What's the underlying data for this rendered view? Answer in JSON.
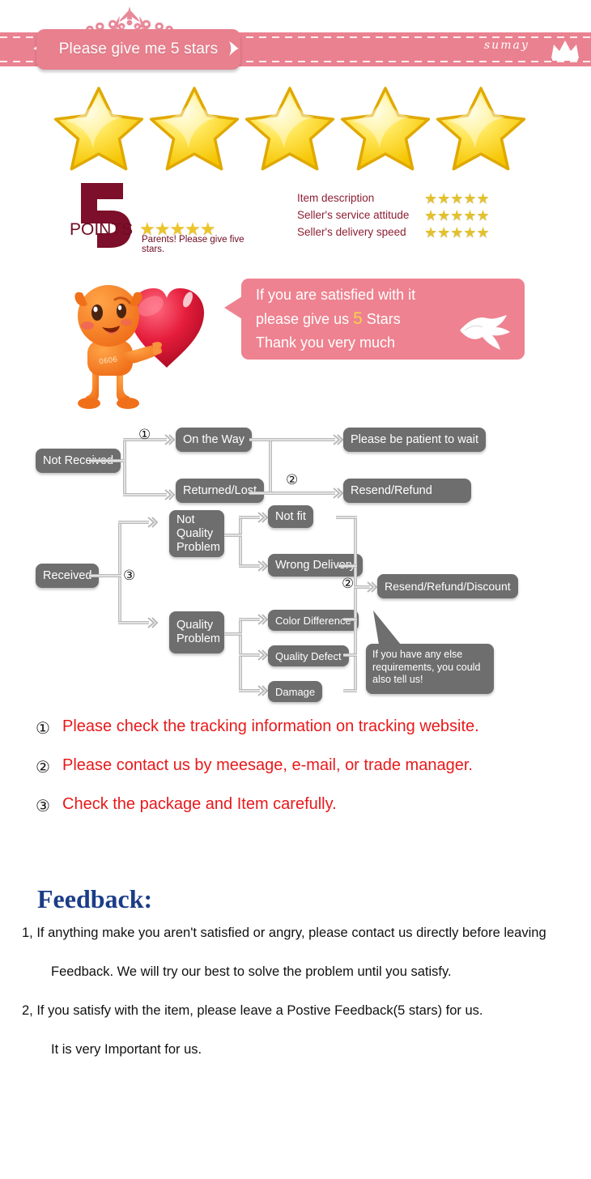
{
  "header": {
    "plate_label": "Please give me 5 stars",
    "brand": "sumay",
    "tiara_icon": "tiara-icon",
    "crown_icon": "crown-icon",
    "band_color": "#ea8190",
    "plate_color": "#e8808e"
  },
  "big_stars": {
    "count": 5,
    "color": "#ffd400"
  },
  "points": {
    "number": "5",
    "label": "POINTS",
    "mini_stars": "★★★★★",
    "caption": "Parents! Please give five stars.",
    "color": "#6e0c22"
  },
  "ratings": {
    "stars": "★★★★★",
    "star_color": "#e3c12b",
    "rows": [
      {
        "label": "Item description"
      },
      {
        "label": "Seller's service attitude"
      },
      {
        "label": "Seller's delivery speed"
      }
    ]
  },
  "bubble": {
    "line1": "If you are satisfied with it",
    "line2_pre": "please give us ",
    "line2_num": "5",
    "line2_post": " Stars",
    "line3": "Thank you very much",
    "bg_color": "#ee8290",
    "num_color": "#f7d34a",
    "lips_icon": "lips-kiss-icon",
    "mascot_icon": "mascot-holding-heart-icon"
  },
  "flow": {
    "box_color": "#6e6e6e",
    "not_received": "Not Received",
    "on_the_way": "On the Way",
    "returned_lost": "Returned/Lost",
    "please_wait": "Please be patient to wait",
    "resend_refund": "Resend/Refund",
    "received": "Received",
    "not_quality_problem": "Not\nQuality\nProblem",
    "quality_problem": "Quality\nProblem",
    "not_fit": "Not fit",
    "wrong_delivery": "Wrong Delivery",
    "color_difference": "Color Difference",
    "quality_defect": "Quality Defect",
    "damage": "Damage",
    "resend_refund_discount": "Resend/Refund/Discount",
    "callout": "If you have any else requirements, you could also tell us!",
    "marker_1": "①",
    "marker_2a": "②",
    "marker_2b": "②",
    "marker_3": "③"
  },
  "notes": [
    {
      "num": "①",
      "text": "Please check the tracking information on tracking website."
    },
    {
      "num": "②",
      "text": "Please contact us by meesage, e-mail, or trade manager."
    },
    {
      "num": "③",
      "text": "Check the package and Item carefully."
    }
  ],
  "note_color": "#e8191b",
  "feedback": {
    "title": "Feedback:",
    "title_color": "#1b3d87",
    "line1a": "1, If anything make you aren't satisfied or angry, please contact us directly before leaving",
    "line1b": "Feedback. We will try our best to solve the problem until you satisfy.",
    "line2a": "2, If you satisfy with the item, please leave a Postive Feedback(5 stars) for us.",
    "line2b": "It is very Important for us."
  }
}
